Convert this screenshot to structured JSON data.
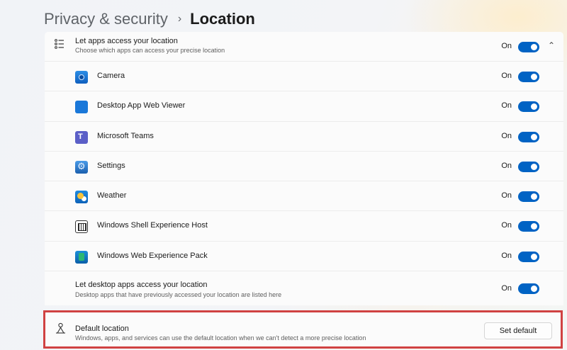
{
  "breadcrumb": {
    "parent": "Privacy & security",
    "separator": "›",
    "current": "Location"
  },
  "header_row": {
    "title": "Let apps access your location",
    "description": "Choose which apps can access your precise location",
    "state": "On",
    "icon": "list-icon",
    "expanded_icon": "chevron-up-icon"
  },
  "apps": [
    {
      "name": "Camera",
      "state": "On",
      "icon": "camera-icon"
    },
    {
      "name": "Desktop App Web Viewer",
      "state": "On",
      "icon": "desktop-app-web-viewer-icon"
    },
    {
      "name": "Microsoft Teams",
      "state": "On",
      "icon": "teams-icon"
    },
    {
      "name": "Settings",
      "state": "On",
      "icon": "settings-gear-icon"
    },
    {
      "name": "Weather",
      "state": "On",
      "icon": "weather-icon"
    },
    {
      "name": "Windows Shell Experience Host",
      "state": "On",
      "icon": "shell-host-icon"
    },
    {
      "name": "Windows Web Experience Pack",
      "state": "On",
      "icon": "web-experience-icon"
    }
  ],
  "desktop_apps_row": {
    "title": "Let desktop apps access your location",
    "description": "Desktop apps that have previously accessed your location are listed here",
    "state": "On"
  },
  "default_location": {
    "title": "Default location",
    "description": "Windows, apps, and services can use the default location when we can't detect a more precise location",
    "button": "Set default",
    "icon": "person-pin-icon"
  },
  "colors": {
    "toggle_on": "#0063c4",
    "highlight_border": "#d04242"
  }
}
